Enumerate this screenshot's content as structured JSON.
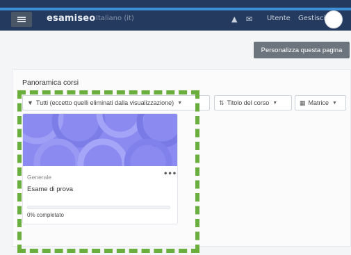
{
  "header": {
    "brand": "esamiseo",
    "subtitle": "Italiano (it)",
    "icons": [
      "bell-icon",
      "chat-icon"
    ],
    "user_name": "Utente",
    "user_menu": "Gestisci"
  },
  "page": {
    "customize_button": "Personalizza questa pagina"
  },
  "course_overview": {
    "title": "Panoramica corsi",
    "filter_label": "Tutti (eccetto quelli eliminati dalla visualizzazione)",
    "sort_label": "Titolo del corso",
    "view_label": "Matrice",
    "courses": [
      {
        "category": "Generale",
        "name": "Esame di prova",
        "progress_percent": 0,
        "progress_text": "0% completato"
      }
    ]
  },
  "colors": {
    "navbar": "#243a5e",
    "accent_line": "#3d8fd6",
    "card_image": "#8a8af0",
    "highlight": "#6aae3e"
  }
}
